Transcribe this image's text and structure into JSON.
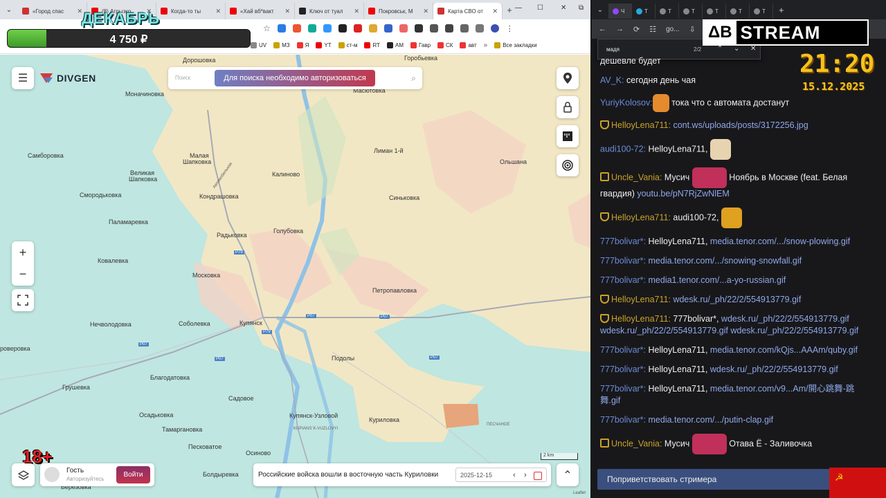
{
  "left_browser": {
    "tabs": [
      {
        "label": "«Город спас",
        "color": "#c33"
      },
      {
        "label": "(8) Агрызко",
        "color": "#e00"
      },
      {
        "label": "Когда-то ты",
        "color": "#e00"
      },
      {
        "label": "«Хай вб*вакт",
        "color": "#e00"
      },
      {
        "label": "Ключ от туал",
        "color": "#222"
      },
      {
        "label": "Покровськ, М",
        "color": "#e00"
      },
      {
        "label": "Карта СВО от",
        "color": "#c33"
      }
    ],
    "bookmarks": [
      "UV",
      "МЗ",
      "Я",
      "YT",
      "ст-м",
      "RT",
      "AM",
      "Гавр",
      "СК",
      "авт",
      "Все закладки"
    ]
  },
  "overlay": {
    "month": "ДЕКАБРЬ",
    "donation_value": "4 750 ₽",
    "donation_fraction": 0.16,
    "age_rating": "18+"
  },
  "map": {
    "logo": "DIVGEN",
    "search_placeholder": "Поиск",
    "auth_button": "Для поиска необходимо авторизоваться",
    "labels": {
      "doroshovka": "Дорошовка",
      "gorobyevka": "Горобьевка",
      "monachinovka": "Моначиновка",
      "masyutovka": "Масютовка",
      "samborovka": "Самборовка",
      "malaya_shapkovka": "Малая",
      "malaya_shapkovka2": "Шапковка",
      "velikaya": "Великая",
      "velikaya2": "Шапковка",
      "liman": "Лиман 1-й",
      "olshana": "Ольшана",
      "kalinovo": "Калиново",
      "smorodkovka": "Смородьковка",
      "kondrashovka": "Кондрашовка",
      "sinkovka": "Синьковка",
      "palamarevka": "Паламаревка",
      "golubovka": "Голубовка",
      "radkovka": "Радьковка",
      "kovalevka": "Ковалевка",
      "moskovka": "Московка",
      "petropavlovka": "Петропавловка",
      "nechvolodovka": "Нечволодовка",
      "sobolevka": "Соболевка",
      "kupyansk": "Купянск",
      "bolshaya": "роверовка",
      "podoly": "Подолы",
      "blagodatovka": "Благодатовка",
      "grushevka": "Грушевка",
      "sadovoe": "Садовое",
      "osadkovka": "Осадьковка",
      "kupyansk_uzlovoi": "Купянск-Узловой",
      "kupyansk_uzlovoi_en": "KUPIANS`K-VUZLOVYI",
      "kurilovka": "Куриловка",
      "pesch": "ПЕСЧАНОЕ",
      "tamarganovka": "Тамаргановка",
      "peski": "Песковатое",
      "osinovo": "Осиново",
      "boldyrevka": "Болдыревка",
      "berezovka": "Березовка",
      "dvurechnaya": "Автомобильная",
      "road_tag_ex": "Р79"
    },
    "road_tags": [
      "P79",
      "P07",
      "P07",
      "P07",
      "P07",
      "P79",
      "P07"
    ],
    "scale": "2 km",
    "attribution": "Leaflet",
    "guest": {
      "name": "Гость",
      "sub": "Авторизуйтесь",
      "login": "Войти"
    },
    "news": {
      "text": "Российские войска вошли в восточную часть Куриловки",
      "date": "2025-12-15"
    }
  },
  "right_browser": {
    "address": "go...",
    "find_query": "мадя",
    "find_count": "2/2",
    "logo_left": "ΔВ",
    "logo_right": "STREAM",
    "time": "21:20",
    "date": "15.12.2025"
  },
  "chat": [
    {
      "user": "",
      "text": "дешевле будет",
      "link": ""
    },
    {
      "user": "AV_K:",
      "text": " сегодня день чая",
      "link": ""
    },
    {
      "user": "YuriyKolosov:",
      "text": " тока что с автомата достанут",
      "link": ""
    },
    {
      "user": "HelloyLena711:",
      "text": " ",
      "link": "cont.ws/uploads/posts/3172256.jpg"
    },
    {
      "user": "audi100-72:",
      "text": " HelloyLena711,",
      "link": ""
    },
    {
      "user": "Uncle_Vania:",
      "text": " Мусич",
      "text2": " Ноябрь в Москве (feat. Белая гвардия) ",
      "link": "youtu.be/pN7RjZwNlEM"
    },
    {
      "user": "HelloyLena711:",
      "text": " audi100-72,",
      "link": ""
    },
    {
      "user": "777bolivar*:",
      "text": " HelloyLena711, ",
      "link": "media.tenor.com/.../snow-plowing.gif"
    },
    {
      "user": "777bolivar*:",
      "text": " ",
      "link": "media.tenor.com/.../snowing-snowfall.gif"
    },
    {
      "user": "777bolivar*:",
      "text": " ",
      "link": "media1.tenor.com/...a-yo-russian.gif"
    },
    {
      "user": "HelloyLena711:",
      "text": " ",
      "link": "wdesk.ru/_ph/22/2/554913779.gif"
    },
    {
      "user": "HelloyLena711:",
      "text": " 777bolivar*, ",
      "link": "wdesk.ru/_ph/22/2/554913779.gif wdesk.ru/_ph/22/2/554913779.gif wdesk.ru/_ph/22/2/554913779.gif"
    },
    {
      "user": "777bolivar*:",
      "text": " HelloyLena711, ",
      "link": "media.tenor.com/kQjs...AAAm/quby.gif"
    },
    {
      "user": "777bolivar*:",
      "text": " HelloyLena711, ",
      "link": "wdesk.ru/_ph/22/2/554913779.gif"
    },
    {
      "user": "777bolivar*:",
      "text": " HelloyLena711, ",
      "link": "media.tenor.com/v9...Am/開心跳舞-跳舞.gif"
    },
    {
      "user": "777bolivar*:",
      "text": " ",
      "link": "media.tenor.com/.../putin-clap.gif"
    },
    {
      "user": "Uncle_Vania:",
      "text": " Мусич",
      "text2": " Отава Ё - Заливочка",
      "link": ""
    }
  ],
  "greet_button": "Поприветствовать стримера",
  "colors": {
    "accent": "#6b8bd4",
    "gold": "#c9a227",
    "ru_zone": "#f2e7c4",
    "ua_zone": "#bfe6e0"
  }
}
